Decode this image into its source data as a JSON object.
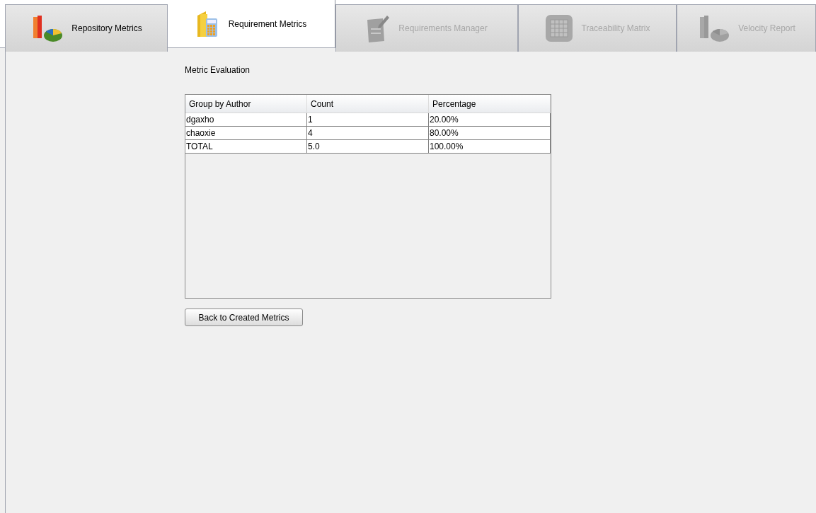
{
  "tabs": [
    {
      "label": "Repository Metrics",
      "kind": "charts",
      "selected": false,
      "disabled": false
    },
    {
      "label": "Requirement Metrics",
      "kind": "calculator",
      "selected": true,
      "disabled": false
    },
    {
      "label": "Requirements Manager",
      "kind": "checklist",
      "selected": false,
      "disabled": true
    },
    {
      "label": "Traceability Matrix",
      "kind": "grid",
      "selected": false,
      "disabled": true
    },
    {
      "label": "Velocity Report",
      "kind": "charts",
      "selected": false,
      "disabled": true
    }
  ],
  "heading": "Metric Evaluation",
  "table": {
    "columns": [
      "Group by Author",
      "Count",
      "Percentage"
    ],
    "rows": [
      [
        "dgaxho",
        "1",
        "20.00%"
      ],
      [
        "chaoxie",
        "4",
        "80.00%"
      ],
      [
        "TOTAL",
        "5.0",
        "100.00%"
      ]
    ]
  },
  "back_button": "Back to Created Metrics"
}
